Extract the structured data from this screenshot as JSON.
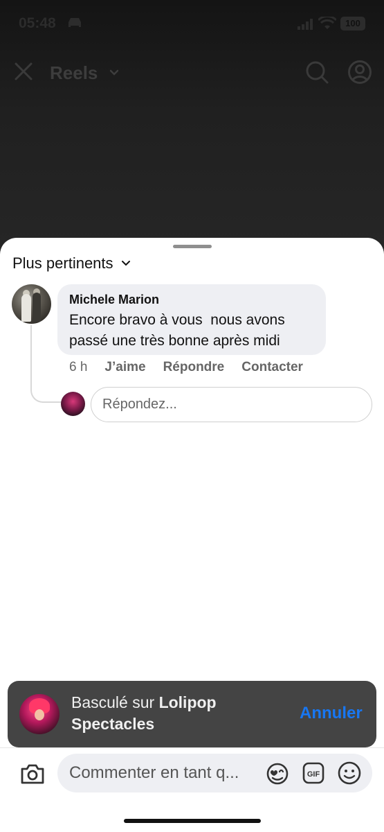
{
  "status_bar": {
    "time": "05:48",
    "battery": "100"
  },
  "header": {
    "title": "Reels"
  },
  "sheet": {
    "sort_label": "Plus pertinents",
    "comment": {
      "author": "Michele Marion",
      "text": "Encore bravo à vous  nous avons passé une très bonne après midi",
      "time": "6 h",
      "like_label": "J’aime",
      "reply_label": "Répondre",
      "contact_label": "Contacter"
    },
    "reply_placeholder": "Répondez..."
  },
  "toast": {
    "prefix": "Basculé sur ",
    "page_name": "Lolipop Spectacles",
    "undo_label": "Annuler",
    "undo_color": "#1877f2"
  },
  "composer": {
    "placeholder": "Commenter en tant q..."
  },
  "icons": {
    "close": "close-icon",
    "chevron": "chevron-down-icon",
    "search": "search-icon",
    "profile": "profile-icon",
    "camera": "camera-icon",
    "sticker": "sticker-icon",
    "gif": "gif-icon",
    "emoji": "emoji-icon"
  }
}
